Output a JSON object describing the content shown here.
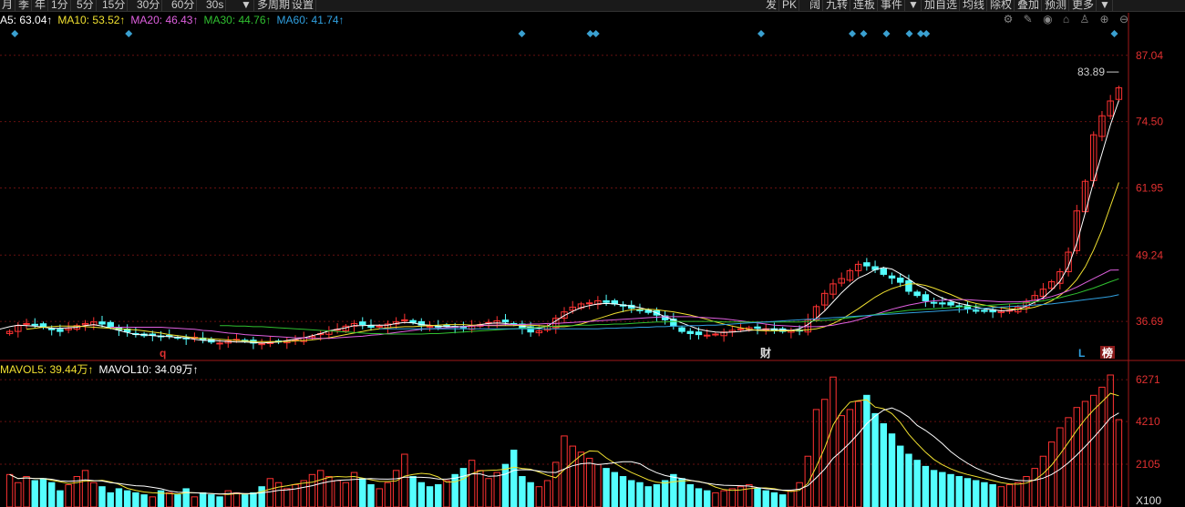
{
  "toolbar": {
    "left_items": [
      "月",
      "季",
      "年",
      "1分",
      "5分",
      "15分",
      "30分",
      "60分",
      "30s",
      "▼",
      "多周期",
      "设置"
    ],
    "right_items": [
      "发",
      "PK",
      "阔",
      "九转",
      "连板",
      "事件",
      "▼",
      "加自选",
      "均线",
      "除权",
      "叠加",
      "预测",
      "更多",
      "▼"
    ]
  },
  "ma_legend": [
    {
      "label": "A5: 63.04↑",
      "color": "#ffffff"
    },
    {
      "label": "MA10: 53.52↑",
      "color": "#f0e030"
    },
    {
      "label": "MA20: 46.43↑",
      "color": "#e060e0"
    },
    {
      "label": "MA30: 44.76↑",
      "color": "#30c030"
    },
    {
      "label": "MA60: 41.74↑",
      "color": "#30a0e0"
    }
  ],
  "volume_legend": [
    {
      "label": "MAVOL5: 39.44万↑",
      "color": "#f0e030"
    },
    {
      "label": "MAVOL10: 34.09万↑",
      "color": "#ffffff"
    }
  ],
  "price_axis": {
    "ticks": [
      "87.04",
      "74.50",
      "61.95",
      "49.24",
      "36.69"
    ],
    "high_label": "83.89"
  },
  "volume_axis": {
    "ticks": [
      "6271",
      "4210",
      "2105"
    ],
    "unit": "X100"
  },
  "chart_markers": [
    {
      "text": "q",
      "color": "#e03030"
    },
    {
      "text": "财",
      "color": "#dddddd"
    },
    {
      "text": "L",
      "color": "#30a0e0"
    },
    {
      "text": "榜",
      "color": "#ffffff"
    }
  ],
  "chart_data": {
    "type": "candlestick",
    "price_ylim": [
      30,
      92
    ],
    "volume_ylim": [
      0,
      6500
    ],
    "colors": {
      "up": "#ff3232",
      "down": "#54ffff",
      "grid": "#661111",
      "axis": "#e03030"
    },
    "close": [
      34.8,
      35.9,
      36.3,
      36.1,
      35.6,
      35.2,
      34.8,
      35.4,
      35.9,
      36.3,
      36.6,
      36.2,
      35.6,
      35.1,
      34.7,
      34.3,
      34.0,
      34.1,
      33.9,
      34.0,
      33.6,
      33.4,
      33.7,
      33.2,
      32.8,
      32.6,
      33.0,
      33.3,
      33.0,
      32.6,
      32.5,
      32.7,
      32.8,
      33.0,
      33.2,
      33.6,
      33.9,
      34.4,
      34.9,
      35.2,
      35.8,
      36.3,
      36.1,
      35.6,
      35.8,
      36.2,
      36.6,
      37.0,
      36.5,
      36.0,
      35.8,
      35.7,
      35.9,
      35.6,
      35.5,
      35.8,
      36.1,
      36.5,
      36.8,
      36.6,
      36.2,
      35.4,
      34.7,
      34.9,
      35.8,
      37.3,
      38.5,
      39.4,
      40.0,
      40.2,
      40.6,
      40.3,
      40.0,
      39.6,
      39.2,
      38.8,
      38.4,
      37.9,
      37.0,
      35.8,
      34.8,
      34.4,
      34.2,
      34.1,
      34.3,
      34.7,
      35.0,
      35.3,
      35.5,
      35.4,
      35.3,
      35.0,
      34.8,
      34.9,
      35.0,
      37.0,
      39.5,
      42.0,
      43.8,
      44.8,
      46.3,
      47.5,
      47.2,
      46.5,
      45.6,
      44.9,
      44.1,
      42.4,
      41.6,
      40.6,
      40.2,
      40.0,
      39.8,
      39.5,
      39.1,
      38.8,
      38.6,
      38.5,
      38.6,
      38.8,
      39.4,
      40.4,
      41.6,
      42.8,
      44.2,
      46.1,
      49.8,
      57.6,
      63.2,
      72.0,
      75.6,
      78.4,
      80.9
    ],
    "volume": [
      1600,
      1200,
      1500,
      1300,
      1400,
      1200,
      800,
      1100,
      1500,
      1800,
      1200,
      1000,
      700,
      900,
      800,
      700,
      600,
      500,
      800,
      700,
      600,
      900,
      500,
      700,
      600,
      500,
      800,
      700,
      600,
      700,
      1000,
      1400,
      1200,
      900,
      1100,
      1300,
      1600,
      1800,
      1500,
      1300,
      1200,
      1700,
      1400,
      1100,
      900,
      1200,
      1800,
      2600,
      1500,
      1200,
      1000,
      1100,
      1300,
      1600,
      1900,
      2300,
      1800,
      1400,
      1700,
      2100,
      2800,
      1500,
      1200,
      1000,
      1300,
      2200,
      3500,
      3000,
      2700,
      2400,
      2100,
      1900,
      1700,
      1500,
      1300,
      1200,
      1000,
      1100,
      1300,
      1600,
      1400,
      1100,
      900,
      800,
      700,
      800,
      900,
      1000,
      1100,
      900,
      800,
      700,
      600,
      800,
      1200,
      2500,
      4800,
      5300,
      6400,
      4500,
      4800,
      5200,
      5500,
      4600,
      4100,
      3600,
      3000,
      2600,
      2300,
      2000,
      1800,
      1700,
      1600,
      1500,
      1400,
      1300,
      1200,
      1100,
      1000,
      1100,
      1200,
      1500,
      1900,
      2500,
      3200,
      3900,
      4400,
      4900,
      5200,
      5500,
      5900,
      6500,
      4300
    ],
    "ma5": [
      34.8,
      35.3,
      35.7,
      36.0,
      35.9,
      35.8,
      35.6,
      35.4,
      35.4,
      35.5,
      35.6,
      35.9,
      36.1,
      35.8,
      35.4,
      35.0,
      34.6,
      34.2,
      34.2,
      34.0,
      33.9,
      33.8,
      33.7,
      33.6,
      33.3,
      33.1,
      33.1,
      33.0,
      32.9,
      32.8,
      32.8,
      32.7,
      32.6,
      32.7,
      32.8,
      33.1,
      33.3,
      33.6,
      34.0,
      34.4,
      34.9,
      35.2,
      35.5,
      35.9,
      35.9,
      36.0,
      36.0,
      36.0,
      36.3,
      36.5,
      36.4,
      36.1,
      36.0,
      35.8,
      35.7,
      35.7,
      35.7,
      35.9,
      36.1,
      36.3,
      36.4,
      36.3,
      36.1,
      35.8,
      35.6,
      35.4,
      35.8,
      36.8,
      37.8,
      38.6,
      39.3,
      39.7,
      40.0,
      40.1,
      40.0,
      39.8,
      39.6,
      39.3,
      38.9,
      38.3,
      37.6,
      37.0,
      36.4,
      35.8,
      35.2,
      34.9,
      34.7,
      34.6,
      34.7,
      34.8,
      35.0,
      35.1,
      35.2,
      35.2,
      35.1,
      35.0,
      35.3,
      36.1,
      37.3,
      38.7,
      40.4,
      42.1,
      43.6,
      44.9,
      45.6,
      46.5,
      46.9,
      46.6,
      45.7,
      44.7,
      43.6,
      42.9,
      41.9,
      41.1,
      40.6,
      40.1,
      39.8,
      39.4,
      39.1,
      38.9,
      38.7,
      38.8,
      39.0,
      39.6,
      40.3,
      41.2,
      42.6,
      44.3,
      47.1,
      51.5,
      57.2,
      63.1,
      68.5,
      73.9,
      78.5
    ],
    "ma10": [
      35.2,
      35.4,
      35.6,
      35.7,
      35.8,
      35.8,
      35.8,
      35.7,
      35.6,
      35.5,
      35.4,
      35.3,
      35.2,
      35.1,
      34.9,
      34.7,
      34.5,
      34.2,
      34.0,
      33.8,
      33.6,
      33.5,
      33.4,
      33.3,
      33.2,
      33.1,
      33.0,
      32.9,
      32.9,
      32.9,
      32.9,
      32.9,
      33.0,
      33.1,
      33.2,
      33.4,
      33.6,
      33.9,
      34.2,
      34.5,
      34.8,
      35.1,
      35.3,
      35.5,
      35.6,
      35.7,
      35.7,
      35.8,
      35.9,
      36.0,
      36.1,
      36.1,
      36.1,
      36.0,
      36.0,
      35.9,
      35.9,
      35.9,
      35.9,
      36.0,
      36.0,
      35.9,
      35.8,
      35.7,
      35.7,
      35.9,
      36.2,
      36.7,
      37.2,
      37.7,
      38.2,
      38.6,
      38.9,
      39.0,
      39.0,
      38.9,
      38.7,
      38.5,
      38.2,
      37.9,
      37.5,
      37.1,
      36.6,
      36.2,
      35.8,
      35.5,
      35.2,
      35.0,
      34.9,
      34.9,
      34.9,
      34.9,
      35.0,
      35.1,
      35.3,
      35.7,
      36.3,
      37.1,
      38.1,
      39.1,
      40.2,
      41.3,
      42.2,
      42.9,
      43.4,
      43.8,
      43.8,
      43.5,
      43.0,
      42.4,
      41.8,
      41.1,
      40.5,
      40.1,
      39.8,
      39.5,
      39.3,
      39.1,
      39.0,
      39.1,
      39.4,
      39.9,
      40.6,
      41.6,
      42.9,
      44.6,
      47.0,
      50.2,
      54.0,
      58.5,
      63.0
    ],
    "ma20": [
      35.6,
      35.6,
      35.6,
      35.6,
      35.6,
      35.6,
      35.6,
      35.5,
      35.4,
      35.3,
      35.2,
      35.0,
      34.9,
      34.7,
      34.5,
      34.4,
      34.2,
      34.1,
      34.0,
      33.9,
      33.8,
      33.7,
      33.6,
      33.6,
      33.5,
      33.5,
      33.5,
      33.6,
      33.7,
      33.8,
      33.9,
      34.1,
      34.2,
      34.4,
      34.6,
      34.8,
      35.0,
      35.2,
      35.3,
      35.4,
      35.5,
      35.6,
      35.7,
      35.8,
      35.9,
      36.0,
      36.0,
      36.1,
      36.1,
      36.1,
      36.2,
      36.2,
      36.3,
      36.3,
      36.4,
      36.5,
      36.6,
      36.7,
      36.8,
      36.9,
      37.0,
      37.1,
      37.2,
      37.3,
      37.4,
      37.5,
      37.6,
      37.6,
      37.6,
      37.6,
      37.5,
      37.4,
      37.3,
      37.2,
      37.0,
      36.8,
      36.6,
      36.4,
      36.2,
      36.0,
      35.9,
      35.8,
      35.7,
      35.7,
      35.7,
      35.8,
      36.0,
      36.3,
      36.6,
      37.0,
      37.5,
      38.0,
      38.5,
      39.0,
      39.4,
      39.8,
      40.1,
      40.4,
      40.6,
      40.7,
      40.8,
      40.8,
      40.8,
      40.7,
      40.6,
      40.5,
      40.4,
      40.4,
      40.4,
      40.5,
      40.7,
      41.0,
      41.4,
      41.9,
      42.5,
      43.2,
      44.0,
      44.8,
      45.6,
      46.4,
      46.43
    ],
    "ma30": [
      35.9,
      35.9,
      35.8,
      35.8,
      35.7,
      35.7,
      35.6,
      35.5,
      35.4,
      35.3,
      35.2,
      35.1,
      35.0,
      34.9,
      34.8,
      34.7,
      34.6,
      34.5,
      34.4,
      34.4,
      34.3,
      34.3,
      34.3,
      34.3,
      34.3,
      34.4,
      34.4,
      34.5,
      34.6,
      34.7,
      34.8,
      34.9,
      35.0,
      35.1,
      35.2,
      35.3,
      35.4,
      35.5,
      35.6,
      35.7,
      35.8,
      35.9,
      35.9,
      36.0,
      36.0,
      36.1,
      36.1,
      36.2,
      36.2,
      36.3,
      36.4,
      36.5,
      36.6,
      36.6,
      36.7,
      36.7,
      36.7,
      36.7,
      36.7,
      36.7,
      36.6,
      36.6,
      36.6,
      36.6,
      36.6,
      36.6,
      36.6,
      36.6,
      36.6,
      36.6,
      36.7,
      36.8,
      36.9,
      37.0,
      37.2,
      37.4,
      37.6,
      37.8,
      38.0,
      38.2,
      38.4,
      38.6,
      38.8,
      38.9,
      39.0,
      39.1,
      39.2,
      39.3,
      39.4,
      39.5,
      39.6,
      39.7,
      39.8,
      39.9,
      40.0,
      40.1,
      40.2,
      40.4,
      40.6,
      40.9,
      41.2,
      41.6,
      42.0,
      42.5,
      43.0,
      43.6,
      44.2,
      44.76
    ],
    "ma60": [
      35.3,
      35.3,
      35.3,
      35.3,
      35.3,
      35.3,
      35.3,
      35.3,
      35.3,
      35.3,
      35.3,
      35.3,
      35.3,
      35.3,
      35.3,
      35.3,
      35.3,
      35.3,
      35.3,
      35.3,
      35.3,
      35.3,
      35.3,
      35.3,
      35.3,
      35.3,
      35.3,
      35.4,
      35.4,
      35.5,
      35.5,
      35.6,
      35.6,
      35.7,
      35.7,
      35.8,
      35.8,
      35.9,
      35.9,
      36.0,
      36.0,
      36.1,
      36.2,
      36.3,
      36.4,
      36.5,
      36.6,
      36.7,
      36.8,
      36.9,
      37.0,
      37.1,
      37.2,
      37.3,
      37.4,
      37.5,
      37.6,
      37.7,
      37.8,
      37.9,
      38.0,
      38.1,
      38.2,
      38.3,
      38.4,
      38.5,
      38.6,
      38.7,
      38.8,
      38.9,
      39.0,
      39.1,
      39.2,
      39.3,
      39.4,
      39.5,
      39.6,
      39.7,
      39.8,
      39.9,
      40.0,
      40.2,
      40.4,
      40.6,
      40.8,
      41.0,
      41.2,
      41.4,
      41.74
    ]
  }
}
